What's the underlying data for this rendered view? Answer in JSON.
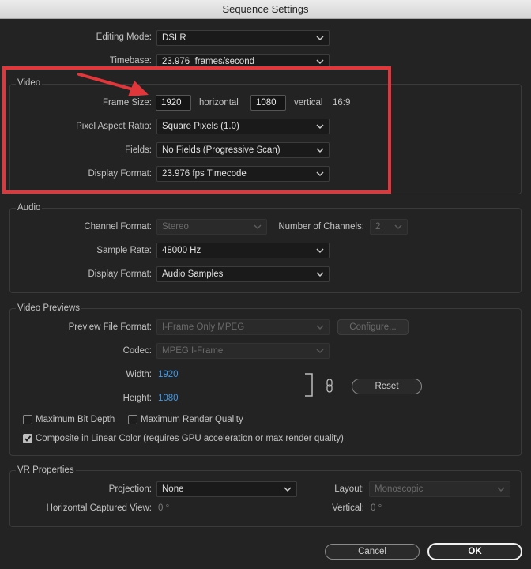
{
  "window": {
    "title": "Sequence Settings"
  },
  "general": {
    "editing_mode": {
      "label": "Editing Mode:",
      "value": "DSLR"
    },
    "timebase": {
      "label": "Timebase:",
      "value": "23.976  frames/second"
    }
  },
  "video": {
    "title": "Video",
    "frame_size_label": "Frame Size:",
    "width": "1920",
    "horizontal_label": "horizontal",
    "height": "1080",
    "vertical_label": "vertical",
    "aspect": "16:9",
    "pixel_aspect": {
      "label": "Pixel Aspect Ratio:",
      "value": "Square Pixels (1.0)"
    },
    "fields": {
      "label": "Fields:",
      "value": "No Fields (Progressive Scan)"
    },
    "display_format": {
      "label": "Display Format:",
      "value": "23.976 fps Timecode"
    }
  },
  "audio": {
    "title": "Audio",
    "channel_format": {
      "label": "Channel Format:",
      "value": "Stereo"
    },
    "num_channels": {
      "label": "Number of Channels:",
      "value": "2"
    },
    "sample_rate": {
      "label": "Sample Rate:",
      "value": "48000 Hz"
    },
    "display_format": {
      "label": "Display Format:",
      "value": "Audio Samples"
    }
  },
  "previews": {
    "title": "Video Previews",
    "file_format": {
      "label": "Preview File Format:",
      "value": "I-Frame Only MPEG"
    },
    "configure_label": "Configure...",
    "codec": {
      "label": "Codec:",
      "value": "MPEG I-Frame"
    },
    "width": {
      "label": "Width:",
      "value": "1920"
    },
    "height": {
      "label": "Height:",
      "value": "1080"
    },
    "reset_label": "Reset",
    "max_bit_depth": {
      "label": "Maximum Bit Depth",
      "checked": false
    },
    "max_render_quality": {
      "label": "Maximum Render Quality",
      "checked": false
    },
    "linear_color": {
      "label": "Composite in Linear Color (requires GPU acceleration or max render quality)",
      "checked": true
    }
  },
  "vr": {
    "title": "VR Properties",
    "projection": {
      "label": "Projection:",
      "value": "None"
    },
    "layout": {
      "label": "Layout:",
      "value": "Monoscopic"
    },
    "h_view": {
      "label": "Horizontal Captured View:",
      "value": "0 °"
    },
    "vertical": {
      "label": "Vertical:",
      "value": "0 °"
    }
  },
  "footer": {
    "cancel_label": "Cancel",
    "ok_label": "OK"
  },
  "colors": {
    "highlight": "#e2373a",
    "link_blue": "#3b9bf0",
    "background": "#232323"
  }
}
